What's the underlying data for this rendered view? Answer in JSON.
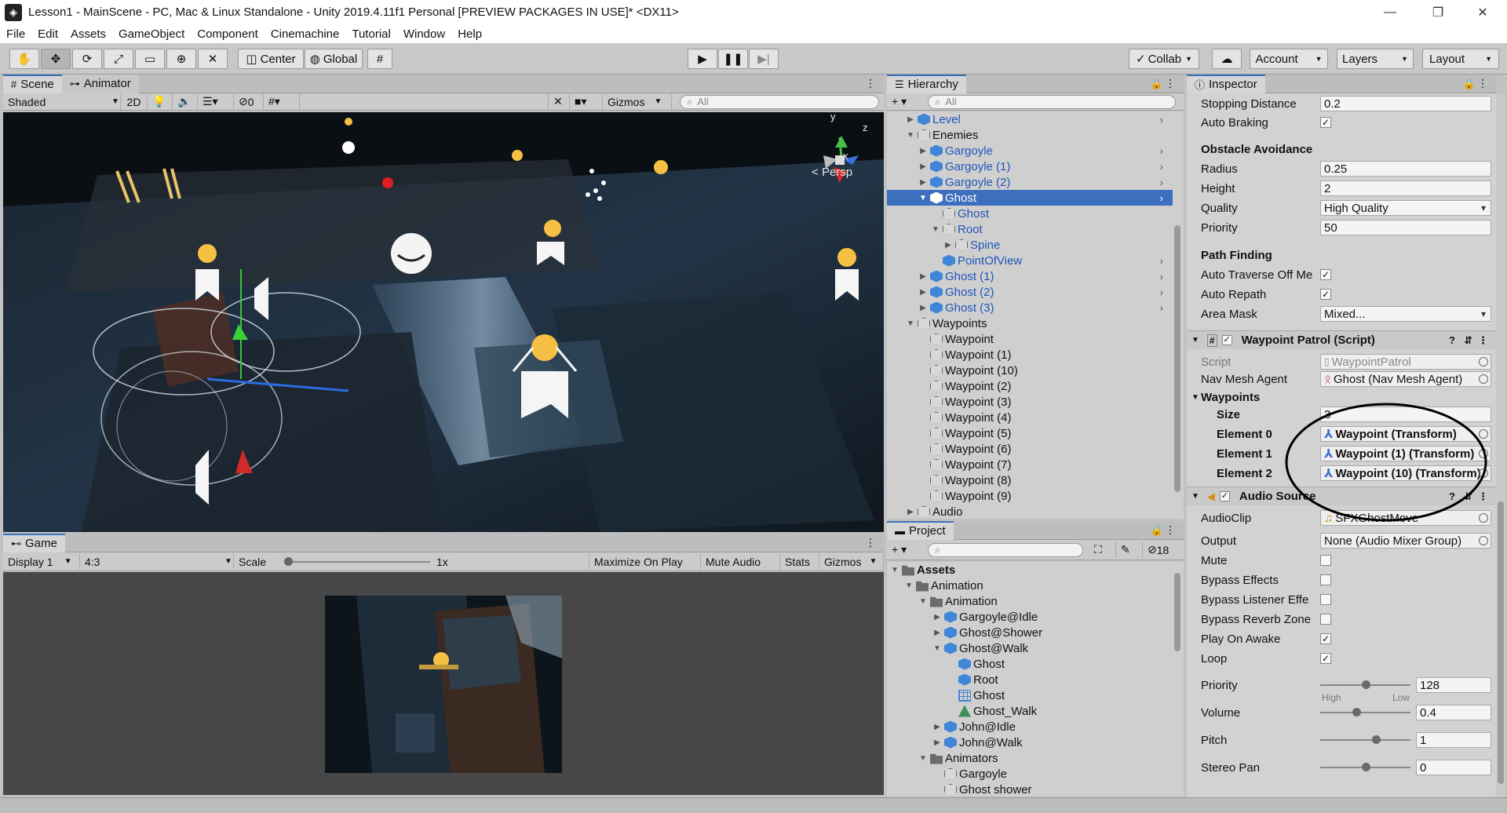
{
  "window": {
    "title": "Lesson1 - MainScene - PC, Mac & Linux Standalone - Unity 2019.4.11f1 Personal [PREVIEW PACKAGES IN USE]* <DX11>"
  },
  "menu": [
    "File",
    "Edit",
    "Assets",
    "GameObject",
    "Component",
    "Cinemachine",
    "Tutorial",
    "Window",
    "Help"
  ],
  "toolbar": {
    "center": "Center",
    "global": "Global",
    "collab": "Collab",
    "account": "Account",
    "layers": "Layers",
    "layout": "Layout"
  },
  "scene": {
    "tab_scene": "Scene",
    "tab_animator": "Animator",
    "shading": "Shaded",
    "mode2d": "2D",
    "hidden_count": "0",
    "gizmos": "Gizmos",
    "search_placeholder": "All",
    "persp": "Persp",
    "axis_x": "x",
    "axis_y": "y",
    "axis_z": "z"
  },
  "game": {
    "tab": "Game",
    "display": "Display 1",
    "aspect": "4:3",
    "scale_label": "Scale",
    "scale_value": "1x",
    "maximize": "Maximize On Play",
    "mute": "Mute Audio",
    "stats": "Stats",
    "gizmos": "Gizmos"
  },
  "hierarchy": {
    "tab": "Hierarchy",
    "search_placeholder": "All",
    "items": [
      {
        "label": "Level",
        "depth": 1,
        "icon": "prefab",
        "tri": "▶",
        "blue": true,
        "arrow": true
      },
      {
        "label": "Enemies",
        "depth": 1,
        "icon": "gameobject",
        "tri": "▼",
        "blue": false,
        "arrow": false
      },
      {
        "label": "Gargoyle",
        "depth": 2,
        "icon": "prefab",
        "tri": "▶",
        "blue": true,
        "arrow": true
      },
      {
        "label": "Gargoyle (1)",
        "depth": 2,
        "icon": "prefab",
        "tri": "▶",
        "blue": true,
        "arrow": true
      },
      {
        "label": "Gargoyle (2)",
        "depth": 2,
        "icon": "prefab",
        "tri": "▶",
        "blue": true,
        "arrow": true
      },
      {
        "label": "Ghost",
        "depth": 2,
        "icon": "prefab",
        "tri": "▼",
        "blue": false,
        "arrow": true,
        "selected": true
      },
      {
        "label": "Ghost",
        "depth": 3,
        "icon": "gameobject",
        "tri": "",
        "blue": true,
        "arrow": false
      },
      {
        "label": "Root",
        "depth": 3,
        "icon": "gameobject",
        "tri": "▼",
        "blue": true,
        "arrow": false
      },
      {
        "label": "Spine",
        "depth": 4,
        "icon": "gameobject",
        "tri": "▶",
        "blue": true,
        "arrow": false
      },
      {
        "label": "PointOfView",
        "depth": 3,
        "icon": "prefab",
        "tri": "",
        "blue": true,
        "arrow": true
      },
      {
        "label": "Ghost (1)",
        "depth": 2,
        "icon": "prefab",
        "tri": "▶",
        "blue": true,
        "arrow": true
      },
      {
        "label": "Ghost (2)",
        "depth": 2,
        "icon": "prefab",
        "tri": "▶",
        "blue": true,
        "arrow": true
      },
      {
        "label": "Ghost (3)",
        "depth": 2,
        "icon": "prefab",
        "tri": "▶",
        "blue": true,
        "arrow": true
      },
      {
        "label": "Waypoints",
        "depth": 1,
        "icon": "gameobject",
        "tri": "▼",
        "blue": false,
        "arrow": false
      },
      {
        "label": "Waypoint",
        "depth": 2,
        "icon": "gameobject",
        "tri": "",
        "blue": false,
        "arrow": false
      },
      {
        "label": "Waypoint (1)",
        "depth": 2,
        "icon": "gameobject",
        "tri": "",
        "blue": false,
        "arrow": false
      },
      {
        "label": "Waypoint (10)",
        "depth": 2,
        "icon": "gameobject",
        "tri": "",
        "blue": false,
        "arrow": false
      },
      {
        "label": "Waypoint (2)",
        "depth": 2,
        "icon": "gameobject",
        "tri": "",
        "blue": false,
        "arrow": false
      },
      {
        "label": "Waypoint (3)",
        "depth": 2,
        "icon": "gameobject",
        "tri": "",
        "blue": false,
        "arrow": false
      },
      {
        "label": "Waypoint (4)",
        "depth": 2,
        "icon": "gameobject",
        "tri": "",
        "blue": false,
        "arrow": false
      },
      {
        "label": "Waypoint (5)",
        "depth": 2,
        "icon": "gameobject",
        "tri": "",
        "blue": false,
        "arrow": false
      },
      {
        "label": "Waypoint (6)",
        "depth": 2,
        "icon": "gameobject",
        "tri": "",
        "blue": false,
        "arrow": false
      },
      {
        "label": "Waypoint (7)",
        "depth": 2,
        "icon": "gameobject",
        "tri": "",
        "blue": false,
        "arrow": false
      },
      {
        "label": "Waypoint (8)",
        "depth": 2,
        "icon": "gameobject",
        "tri": "",
        "blue": false,
        "arrow": false
      },
      {
        "label": "Waypoint (9)",
        "depth": 2,
        "icon": "gameobject",
        "tri": "",
        "blue": false,
        "arrow": false
      },
      {
        "label": "Audio",
        "depth": 1,
        "icon": "gameobject",
        "tri": "▶",
        "blue": false,
        "arrow": false
      }
    ]
  },
  "project": {
    "tab": "Project",
    "hidden_count": "18",
    "items": [
      {
        "label": "Assets",
        "depth": 0,
        "icon": "folder",
        "tri": "▼",
        "bold": true
      },
      {
        "label": "Animation",
        "depth": 1,
        "icon": "folder",
        "tri": "▼"
      },
      {
        "label": "Animation",
        "depth": 2,
        "icon": "folder",
        "tri": "▼"
      },
      {
        "label": "Gargoyle@Idle",
        "depth": 3,
        "icon": "prefab",
        "tri": "▶"
      },
      {
        "label": "Ghost@Shower",
        "depth": 3,
        "icon": "prefab",
        "tri": "▶"
      },
      {
        "label": "Ghost@Walk",
        "depth": 3,
        "icon": "prefab",
        "tri": "▼"
      },
      {
        "label": "Ghost",
        "depth": 4,
        "icon": "prefab",
        "tri": ""
      },
      {
        "label": "Root",
        "depth": 4,
        "icon": "prefab",
        "tri": ""
      },
      {
        "label": "Ghost",
        "depth": 4,
        "icon": "grid",
        "tri": ""
      },
      {
        "label": "Ghost_Walk",
        "depth": 4,
        "icon": "anim",
        "tri": ""
      },
      {
        "label": "John@Idle",
        "depth": 3,
        "icon": "prefab",
        "tri": "▶"
      },
      {
        "label": "John@Walk",
        "depth": 3,
        "icon": "prefab",
        "tri": "▶"
      },
      {
        "label": "Animators",
        "depth": 2,
        "icon": "folder",
        "tri": "▼"
      },
      {
        "label": "Gargoyle",
        "depth": 3,
        "icon": "gameobject",
        "tri": ""
      },
      {
        "label": "Ghost shower",
        "depth": 3,
        "icon": "gameobject",
        "tri": ""
      }
    ]
  },
  "inspector": {
    "tab": "Inspector",
    "stopping_distance": {
      "label": "Stopping Distance",
      "value": "0.2"
    },
    "auto_braking": {
      "label": "Auto Braking",
      "checked": true
    },
    "obstacle_header": "Obstacle Avoidance",
    "radius": {
      "label": "Radius",
      "value": "0.25"
    },
    "height": {
      "label": "Height",
      "value": "2"
    },
    "quality": {
      "label": "Quality",
      "value": "High Quality"
    },
    "priority_nav": {
      "label": "Priority",
      "value": "50"
    },
    "pathfinding_header": "Path Finding",
    "auto_traverse": {
      "label": "Auto Traverse Off Me",
      "checked": true
    },
    "auto_repath": {
      "label": "Auto Repath",
      "checked": true
    },
    "area_mask": {
      "label": "Area Mask",
      "value": "Mixed..."
    },
    "patrol_header": "Waypoint Patrol (Script)",
    "script": {
      "label": "Script",
      "value": "WaypointPatrol"
    },
    "nav_agent": {
      "label": "Nav Mesh Agent",
      "value": "Ghost (Nav Mesh Agent)"
    },
    "waypoints_header": "Waypoints",
    "size": {
      "label": "Size",
      "value": "3"
    },
    "elements": [
      {
        "label": "Element 0",
        "value": "Waypoint (Transform)"
      },
      {
        "label": "Element 1",
        "value": "Waypoint (1) (Transform)"
      },
      {
        "label": "Element 2",
        "value": "Waypoint (10) (Transform)"
      }
    ],
    "audio_header": "Audio Source",
    "audioclip": {
      "label": "AudioClip",
      "value": "SFXGhostMove"
    },
    "output": {
      "label": "Output",
      "value": "None (Audio Mixer Group)"
    },
    "mute": {
      "label": "Mute",
      "checked": false
    },
    "bypass_effects": {
      "label": "Bypass Effects",
      "checked": false
    },
    "bypass_listener": {
      "label": "Bypass Listener Effe",
      "checked": false
    },
    "bypass_reverb": {
      "label": "Bypass Reverb Zone",
      "checked": false
    },
    "play_on_awake": {
      "label": "Play On Awake",
      "checked": true
    },
    "loop": {
      "label": "Loop",
      "checked": true
    },
    "priority": {
      "label": "Priority",
      "value": "128",
      "low_label": "High",
      "high_label": "Low",
      "fraction": 0.5
    },
    "volume": {
      "label": "Volume",
      "value": "0.4",
      "fraction": 0.4
    },
    "pitch": {
      "label": "Pitch",
      "value": "1",
      "fraction": 0.62
    },
    "stereo_pan": {
      "label": "Stereo Pan",
      "value": "0",
      "fraction": 0.5
    }
  }
}
